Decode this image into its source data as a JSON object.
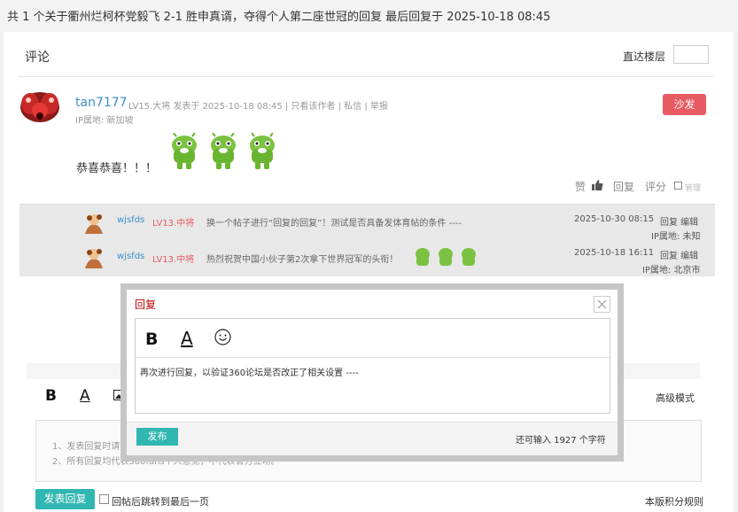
{
  "thread_title": "共 1 个关于衢州烂柯杯党毅飞 2-1 胜申真谞，夺得个人第二座世冠的回复 最后回复于 2025-10-18 08:45",
  "comments": {
    "heading": "评论",
    "jump_label": "直达楼层"
  },
  "post": {
    "username": "tan7177",
    "meta": "LV15.大将   发表于 2025-10-18 08:45  |  只看该作者  |  私信  |  举报",
    "ip": "IP属地: 新加坡",
    "sofa": "沙发",
    "content": "恭喜恭喜！！！",
    "actions": {
      "like": "赞",
      "reply": "回复",
      "rate": "评分",
      "manage": "管理"
    }
  },
  "replies": [
    {
      "user": "wjsfds",
      "level": "LV13.中将",
      "text": "换一个帖子进行“回复的回复”！测试是否具备发体育帖的条件 ----",
      "time": "2025-10-30 08:15",
      "links": "回复 编辑",
      "ip": "IP属地: 未知"
    },
    {
      "user": "wjsfds",
      "level": "LV13.中将",
      "text": "热烈祝贺中国小伙子第2次拿下世界冠军的头衔！",
      "time": "2025-10-18 16:11",
      "links": "回复 编辑",
      "ip": "IP属地: 北京市"
    }
  ],
  "editor": {
    "bold": "B",
    "font": "A",
    "advanced": "高级模式",
    "tips": [
      "1、发表回复时请",
      "2、所有回复均代表360fans个人意见，不代表官方立场。"
    ],
    "post_button": "发表回复",
    "jump_last": "回帖后跳转到最后一页",
    "rules": "本版积分规则"
  },
  "modal": {
    "title": "回复",
    "bold": "B",
    "font": "A",
    "emoji": "☺",
    "text": "再次进行回复，以验证360论坛是否改正了相关设置 ----",
    "publish": "发布",
    "count": "还可输入 1927 个字符"
  },
  "colors": {
    "accent": "#30b7b2",
    "sofa": "#e95b62",
    "username": "#3a8fc8",
    "level": "#e95b62"
  }
}
